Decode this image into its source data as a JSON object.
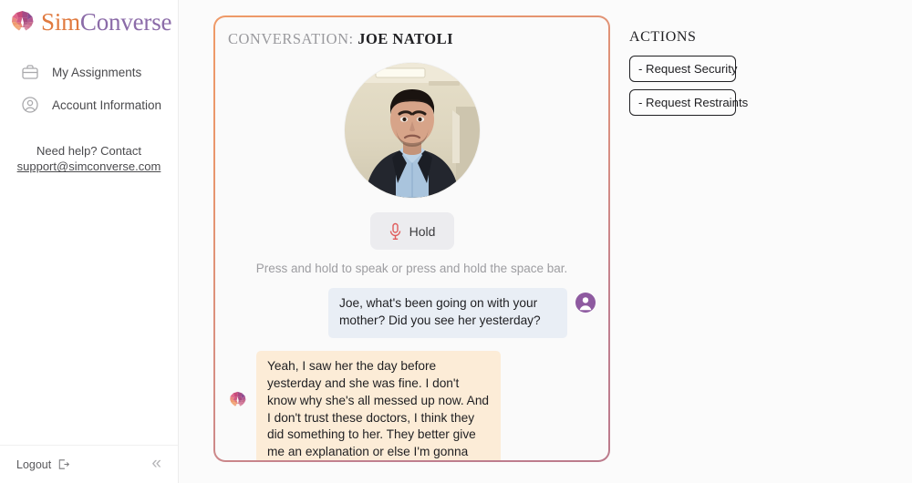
{
  "brand": {
    "name_part1": "Sim",
    "name_part2": "Converse",
    "color_orange": "#e07a3f",
    "color_purple": "#8b6ba8"
  },
  "sidebar": {
    "items": [
      {
        "label": "My Assignments",
        "icon": "briefcase-icon"
      },
      {
        "label": "Account Information",
        "icon": "user-circle-icon"
      }
    ],
    "help": {
      "line1": "Need help? Contact",
      "email": "support@simconverse.com"
    },
    "footer": {
      "logout_label": "Logout",
      "logout_icon": "sign-out-icon",
      "collapse_icon": "chevron-double-left-icon"
    }
  },
  "conversation": {
    "title_label": "CONVERSATION:",
    "title_name": "JOE NATOLI",
    "border_gradient_start": "#ef9a68",
    "border_gradient_end": "#bc7b8c",
    "avatar_alt": "Photo of Joe Natoli",
    "hold_button": {
      "label": "Hold",
      "icon": "microphone-icon",
      "icon_color": "#e05c5c"
    },
    "hint": "Press and hold to speak or press and hold the space bar.",
    "messages": [
      {
        "sender": "user",
        "avatar_icon": "user-avatar-icon",
        "text": "Joe, what's been going on with your mother? Did you see her yesterday?",
        "bubble_color": "#e9eef5"
      },
      {
        "sender": "bot",
        "avatar_icon": "brain-logo-icon",
        "text": "Yeah, I saw her the day before yesterday and she was fine. I don't know why she's all messed up now. And I don't trust these doctors, I think they did something to her. They better give me an explanation or else I'm gonna lose it.",
        "bubble_color": "#fcecd7"
      }
    ]
  },
  "actions": {
    "title": "ACTIONS",
    "buttons": [
      {
        "label": "- Request Security"
      },
      {
        "label": "- Request Restraints"
      }
    ]
  }
}
